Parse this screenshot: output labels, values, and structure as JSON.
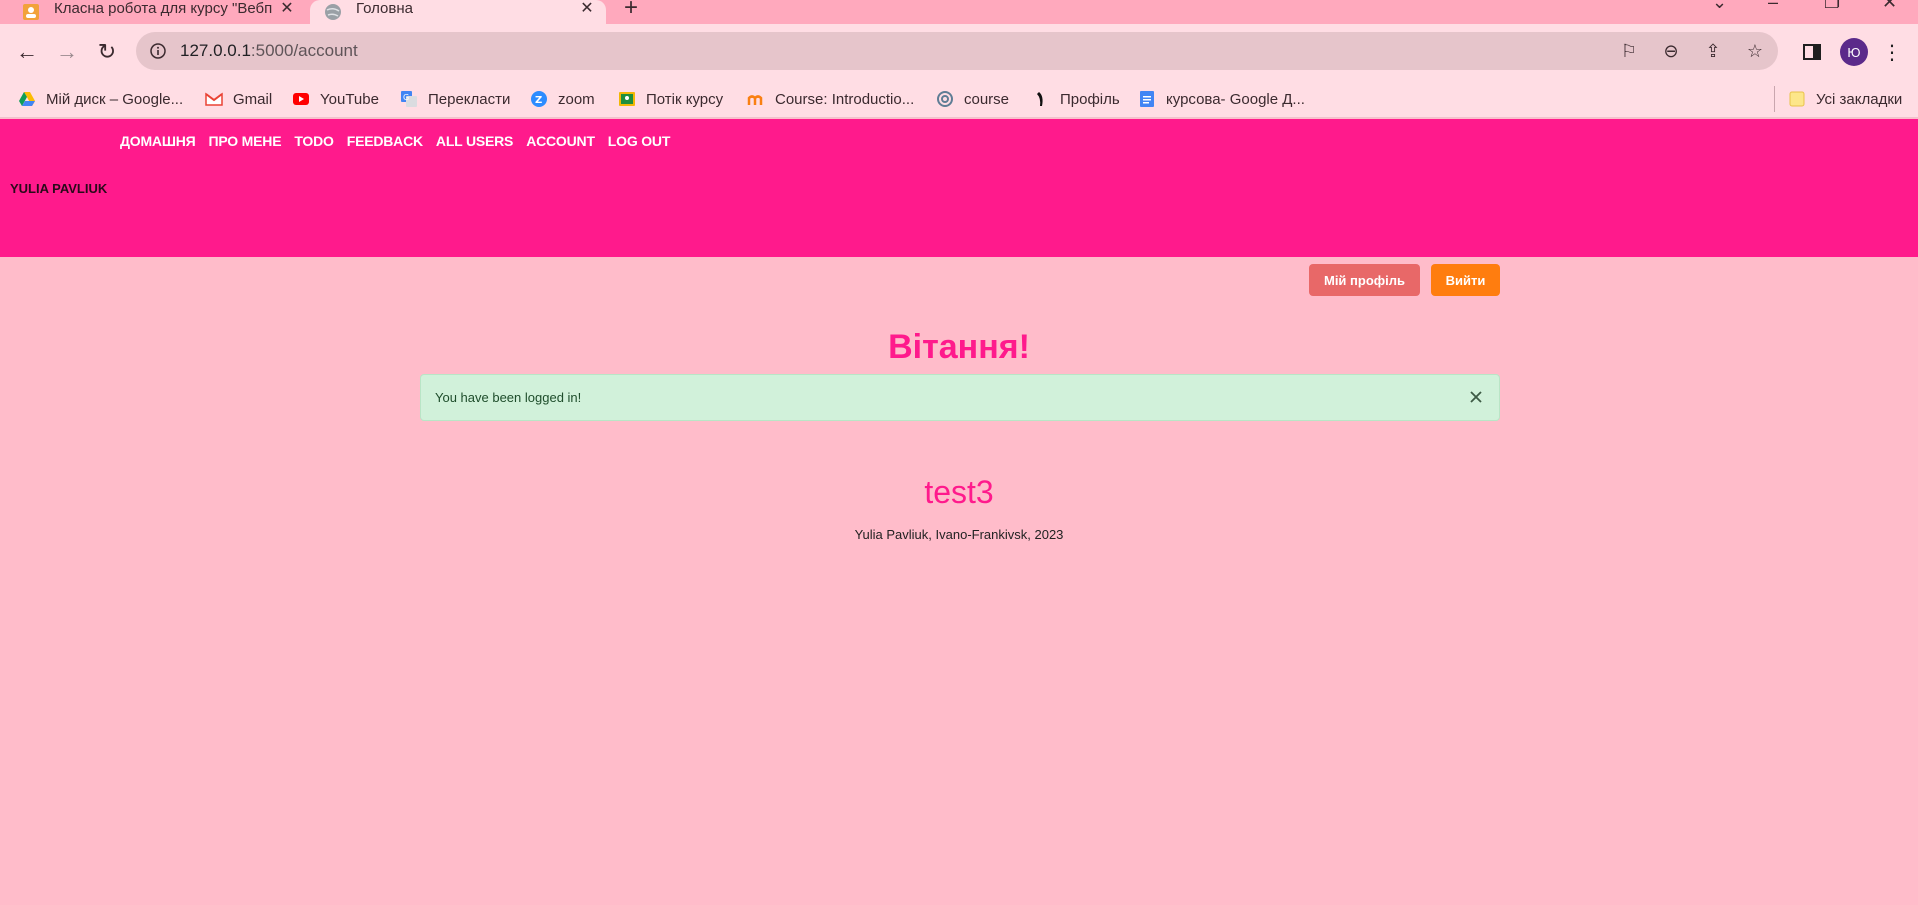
{
  "browser": {
    "tabs": [
      {
        "label": "Класна робота для курсу \"Вебп",
        "active": false,
        "icon": "classroom-icon"
      },
      {
        "label": "Головна",
        "active": true,
        "icon": "globe-icon"
      }
    ],
    "url_host": "127.0.0.1",
    "url_path": ":5000/account",
    "profile_initial": "Ю",
    "bookmarks": [
      {
        "label": "Мій диск – Google...",
        "icon": "google-drive-icon"
      },
      {
        "label": "Gmail",
        "icon": "gmail-icon"
      },
      {
        "label": "YouTube",
        "icon": "youtube-icon"
      },
      {
        "label": "Перекласти",
        "icon": "google-translate-icon"
      },
      {
        "label": "zoom",
        "icon": "zoom-icon"
      },
      {
        "label": "Потік курсу",
        "icon": "classroom-icon"
      },
      {
        "label": "Course: Introductio...",
        "icon": "moodle-icon"
      },
      {
        "label": "course",
        "icon": "course-icon"
      },
      {
        "label": "Профіль",
        "icon": "profile-icon"
      },
      {
        "label": "курсова- Google Д...",
        "icon": "google-docs-icon"
      }
    ],
    "all_bookmarks": "Усі закладки"
  },
  "site": {
    "menu": [
      "ДОМАШНЯ",
      "ПРО МЕНЕ",
      "TODO",
      "FEEDBACK",
      "ALL USERS",
      "ACCOUNT",
      "LOG OUT"
    ],
    "brand": "YULIA PAVLIUK"
  },
  "page": {
    "profile_button": "Мій профіль",
    "logout_button": "Вийти",
    "greeting": "Вітання!",
    "alert_message": "You have been logged in!",
    "username": "test3",
    "footer": "Yulia Pavliuk, Ivano-Frankivsk, 2023"
  },
  "colors": {
    "navbar": "#ff1a8c",
    "page_background": "#ffbcca",
    "accent_text": "#ff1a8c",
    "profile_button": "#e86868",
    "logout_button": "#ff7d0f",
    "alert_background": "#d1f1da"
  }
}
